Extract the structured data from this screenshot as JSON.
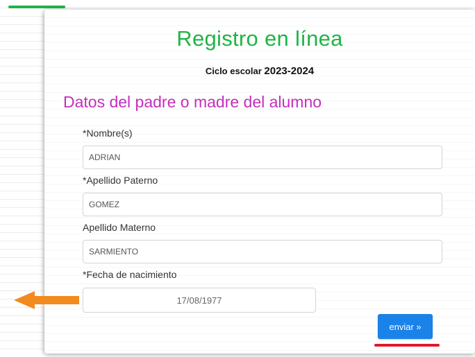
{
  "form": {
    "title": "Registro en línea",
    "cycle_label": "Ciclo escolar",
    "cycle_year": "2023-2024",
    "section_title": "Datos del padre o madre del alumno",
    "fields": [
      {
        "label": "*Nombre(s)",
        "value": "ADRIAN"
      },
      {
        "label": "*Apellido Paterno",
        "value": "GOMEZ"
      },
      {
        "label": "Apellido Materno",
        "value": "SARMIENTO"
      },
      {
        "label": "*Fecha de nacimiento",
        "value": "17/08/1977"
      }
    ],
    "submit_label": "enviar »"
  },
  "colors": {
    "title": "#1fb445",
    "section_title": "#c42fbd",
    "button": "#1a82e8",
    "annotation_arrow": "#f28a1e",
    "annotation_underline": "#e0182d"
  }
}
